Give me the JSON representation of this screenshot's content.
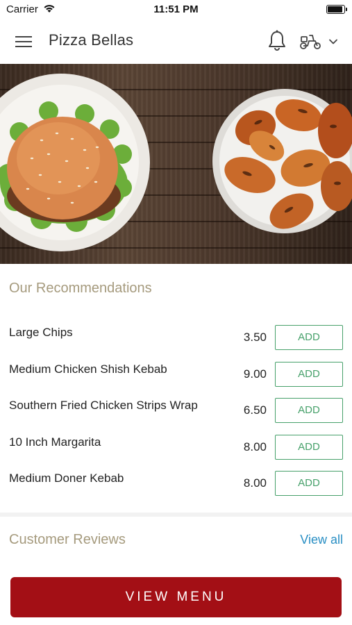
{
  "status_bar": {
    "carrier": "Carrier",
    "time": "11:51 PM",
    "battery_percent": 100
  },
  "nav": {
    "title": "Pizza Bellas",
    "icons": [
      "menu-icon",
      "bell-icon",
      "scooter-icon",
      "chevron-down-icon"
    ]
  },
  "hero": {
    "image": "burger-and-chicken-wings-on-wooden-table"
  },
  "recommendations": {
    "title": "Our Recommendations",
    "items": [
      {
        "name": "Large Chips",
        "price": "3.50",
        "action": "ADD"
      },
      {
        "name": "Medium Chicken Shish Kebab",
        "price": "9.00",
        "action": "ADD"
      },
      {
        "name": "Southern Fried Chicken Strips Wrap",
        "price": "6.50",
        "action": "ADD"
      },
      {
        "name": "10 Inch Margarita",
        "price": "8.00",
        "action": "ADD"
      },
      {
        "name": "Medium Doner Kebab",
        "price": "8.00",
        "action": "ADD"
      }
    ]
  },
  "reviews": {
    "title": "Customer Reviews",
    "view_all": "View all"
  },
  "footer": {
    "view_menu": "VIEW MENU"
  },
  "colors": {
    "accent_red": "#a30f15",
    "add_green": "#46a06a",
    "link_blue": "#2a8fc4",
    "section_title": "#a59a7d"
  }
}
